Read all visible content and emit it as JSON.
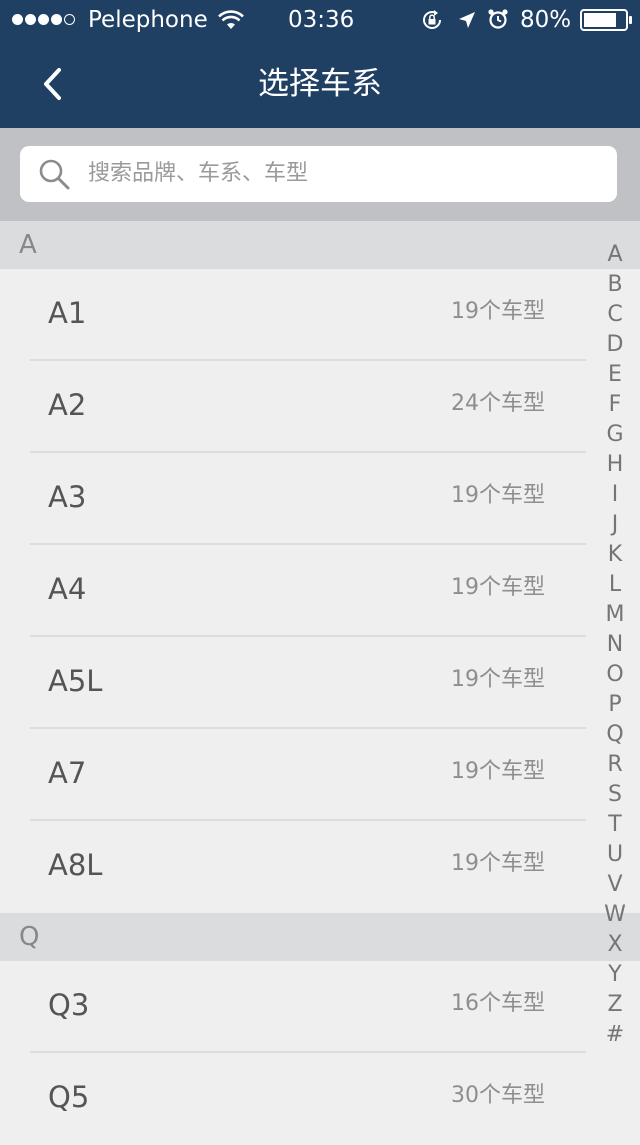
{
  "status_bar": {
    "carrier": "Pelephone",
    "time": "03:36",
    "battery": "80%",
    "battery_level": 0.8,
    "signal_bars_filled": 4,
    "signal_bars_total": 5,
    "icons": [
      "wifi-icon",
      "rotation-lock-icon",
      "location-icon",
      "alarm-icon",
      "battery-icon"
    ]
  },
  "nav": {
    "title": "选择车系",
    "back_icon": "chevron-left-icon"
  },
  "search": {
    "placeholder": "搜索品牌、车系、车型",
    "icon": "search-icon"
  },
  "sections": [
    {
      "letter": "A",
      "rows": [
        {
          "name": "A1",
          "count": "19个车型"
        },
        {
          "name": "A2",
          "count": "24个车型"
        },
        {
          "name": "A3",
          "count": "19个车型"
        },
        {
          "name": "A4",
          "count": "19个车型"
        },
        {
          "name": "A5L",
          "count": "19个车型"
        },
        {
          "name": "A7",
          "count": "19个车型"
        },
        {
          "name": "A8L",
          "count": "19个车型"
        }
      ]
    },
    {
      "letter": "Q",
      "rows": [
        {
          "name": "Q3",
          "count": "16个车型"
        },
        {
          "name": "Q5",
          "count": "30个车型"
        }
      ]
    }
  ],
  "index_letters": [
    "A",
    "B",
    "C",
    "D",
    "E",
    "F",
    "G",
    "H",
    "I",
    "J",
    "K",
    "L",
    "M",
    "N",
    "O",
    "P",
    "Q",
    "R",
    "S",
    "T",
    "U",
    "V",
    "W",
    "X",
    "Y",
    "Z",
    "#"
  ],
  "colors": {
    "header_bg": "#1f3f63",
    "search_area_bg": "#bfc1c5",
    "section_header_bg": "#dbdcde",
    "row_bg": "#efefef"
  }
}
